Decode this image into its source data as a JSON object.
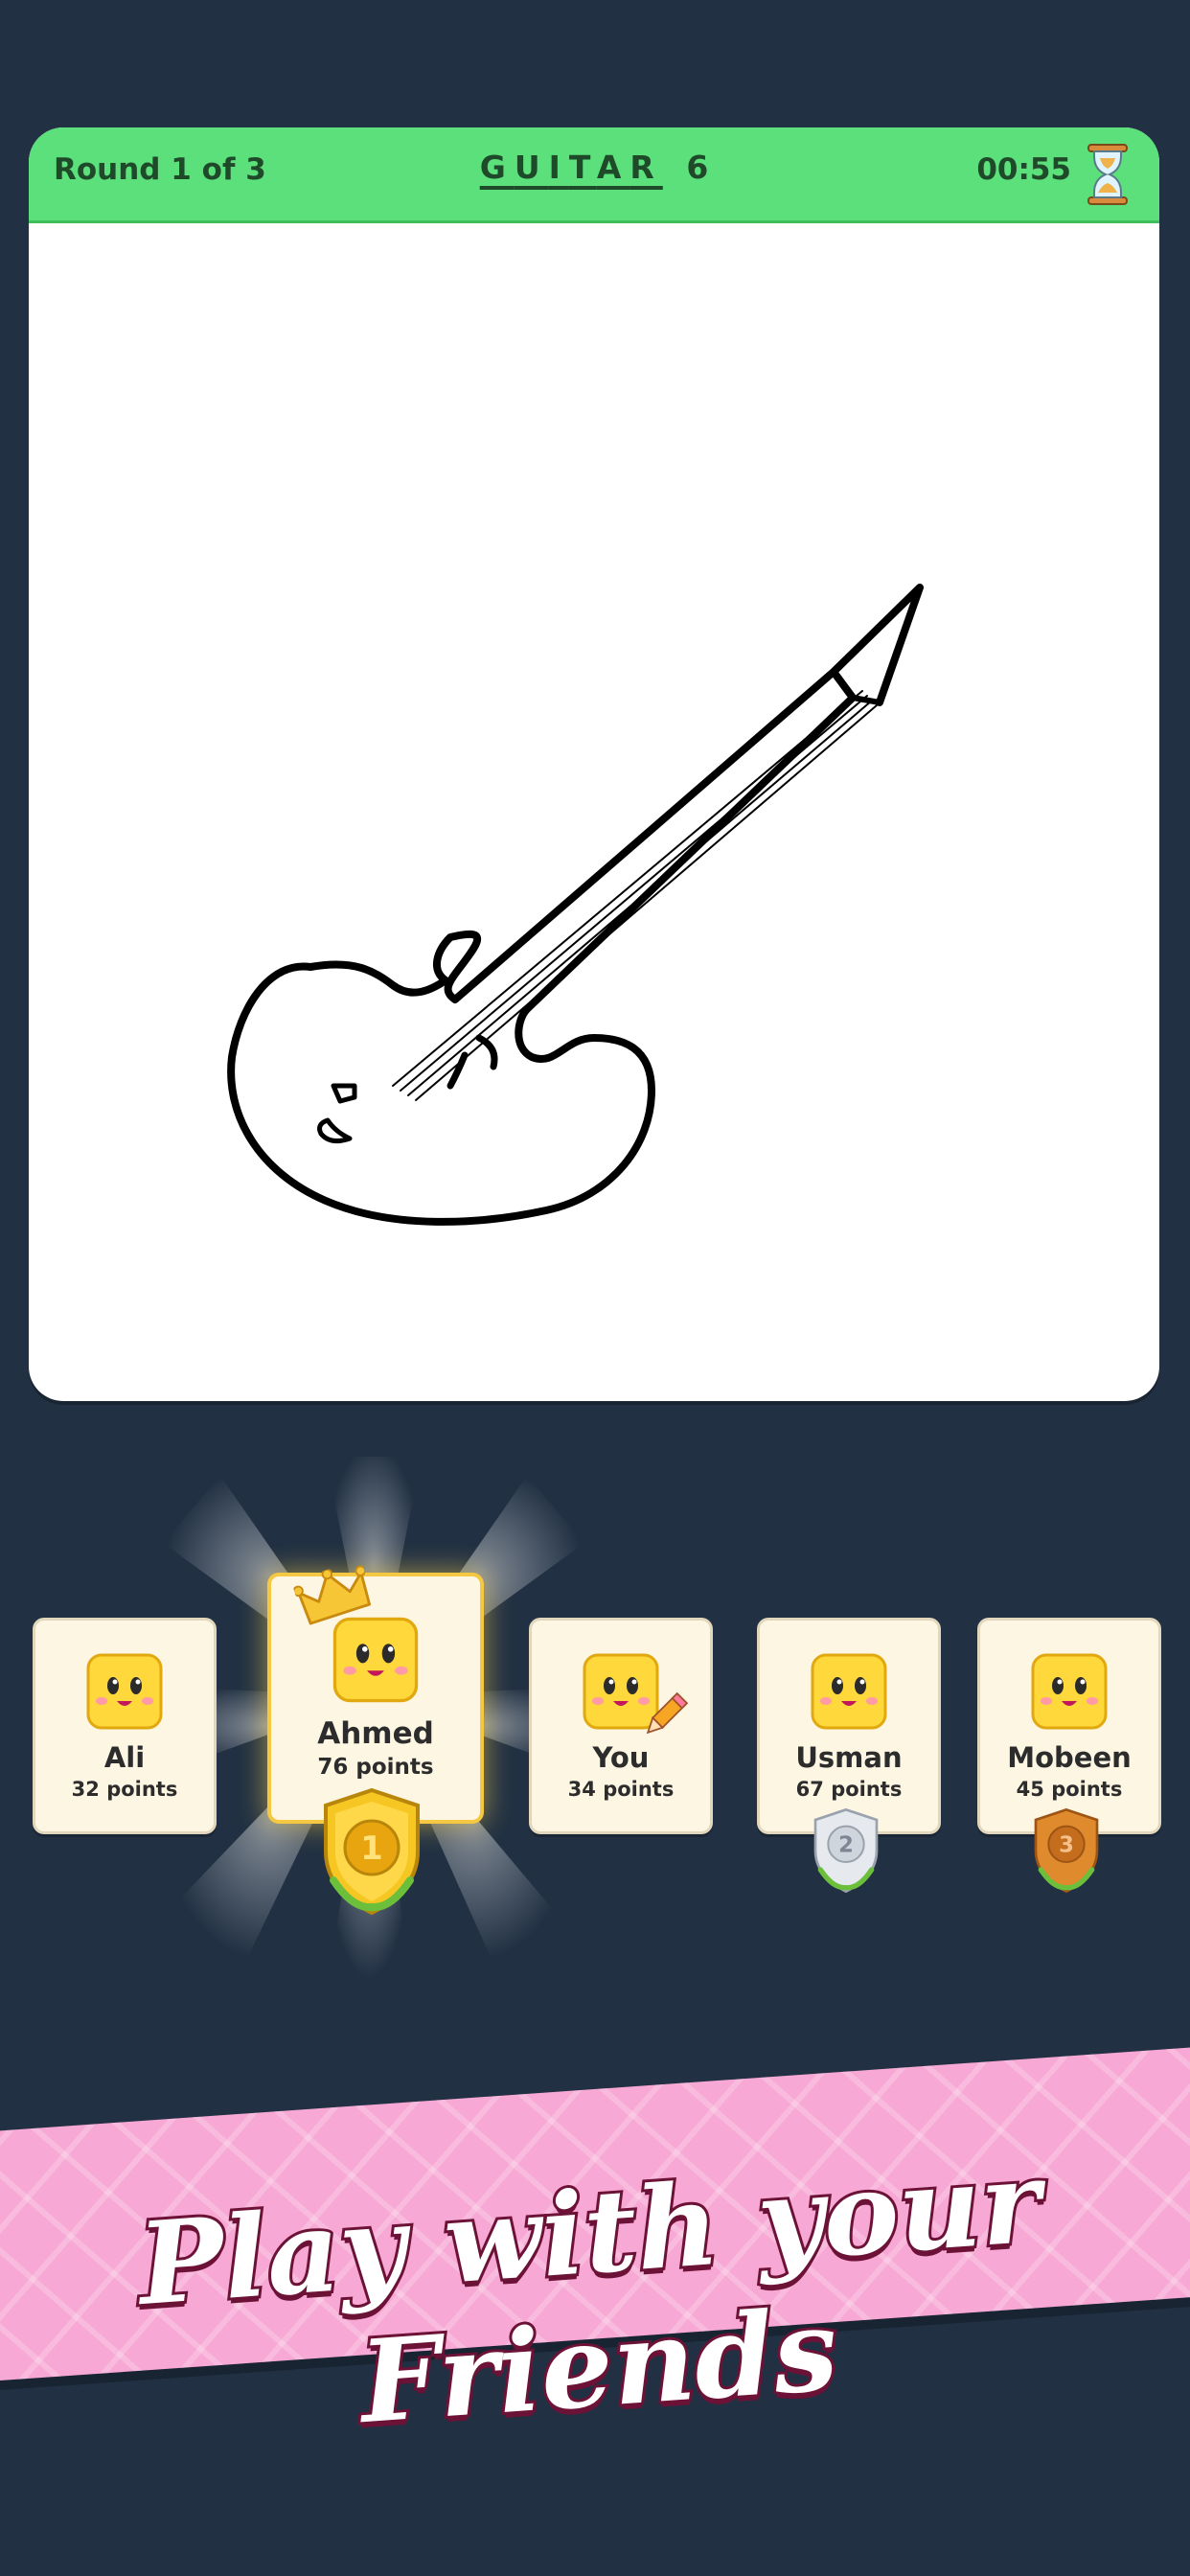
{
  "header": {
    "round": "Round 1 of 3",
    "word_letters": [
      "G",
      "U",
      "I",
      "T",
      "A",
      "R"
    ],
    "word_length": "6",
    "timer": "00:55"
  },
  "players": [
    {
      "name": "Ali",
      "points": "32 points"
    },
    {
      "name": "Ahmed",
      "points": "76 points",
      "rank": "1"
    },
    {
      "name": "You",
      "points": "34 points"
    },
    {
      "name": "Usman",
      "points": "67 points",
      "rank": "2"
    },
    {
      "name": "Mobeen",
      "points": "45 points",
      "rank": "3"
    }
  ],
  "banner": {
    "text": "Play with your Friends"
  },
  "colors": {
    "background": "#213043",
    "topbar": "#5ce07c",
    "card": "#ffffff",
    "player_card": "#fdf6e3",
    "banner": "#f7a8d4",
    "banner_outline": "#6b1236"
  },
  "icons": [
    "hourglass-icon",
    "crown-icon",
    "pencil-icon",
    "gold-medal-icon",
    "silver-medal-icon",
    "bronze-medal-icon",
    "smiley-avatar-icon"
  ]
}
